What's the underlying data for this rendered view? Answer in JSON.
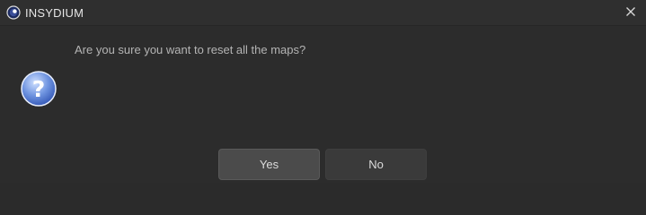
{
  "window": {
    "title": "INSYDIUM",
    "app_icon": "cinema4d-logo-icon",
    "close_icon": "close-icon"
  },
  "dialog": {
    "message": "Are you sure you want to reset all the maps?",
    "icon": "question-icon"
  },
  "buttons": {
    "yes_label": "Yes",
    "no_label": "No"
  },
  "colors": {
    "background": "#2c2c2c",
    "titlebar": "#2f2f2f",
    "text": "#b4b4b4",
    "button_default": "#4b4b4b",
    "button": "#3a3a3a"
  }
}
